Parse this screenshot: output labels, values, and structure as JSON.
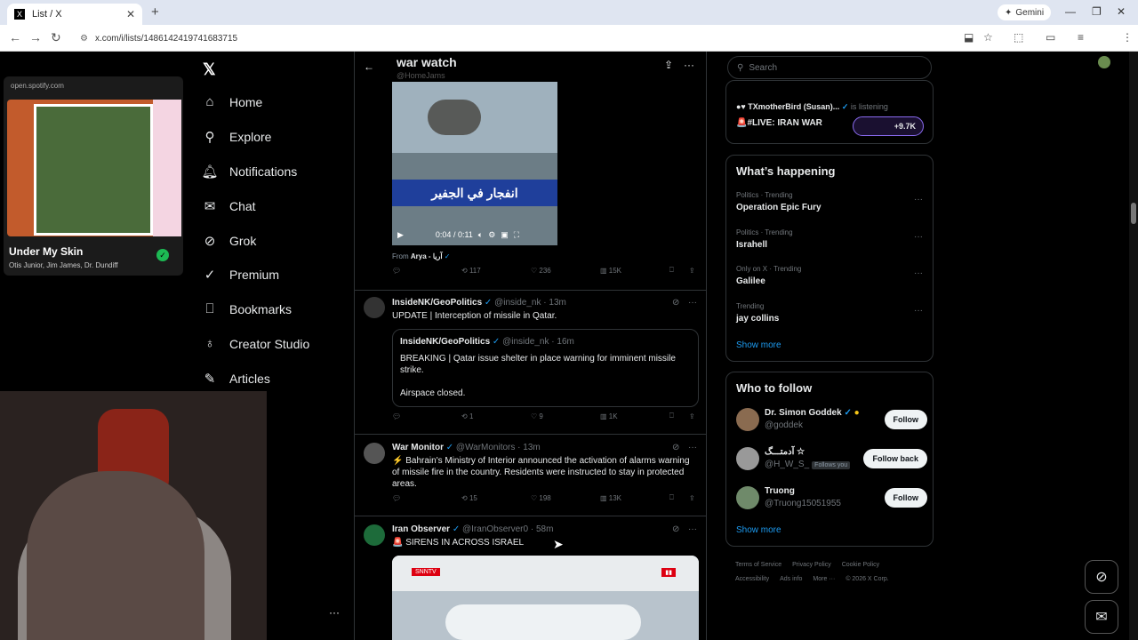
{
  "browser": {
    "tab_title": "List / X",
    "url": "x.com/i/lists/1486142419741683715",
    "gemini_label": "Gemini"
  },
  "spotify": {
    "source": "open.spotify.com",
    "song": "Under My Skin",
    "artists": "Otis Junior, Jim James, Dr. Dundiff"
  },
  "nav": {
    "items": [
      {
        "label": "Home",
        "icon": "home-icon"
      },
      {
        "label": "Explore",
        "icon": "search-icon"
      },
      {
        "label": "Notifications",
        "icon": "bell-icon"
      },
      {
        "label": "Chat",
        "icon": "mail-icon"
      },
      {
        "label": "Grok",
        "icon": "grok-icon"
      },
      {
        "label": "Premium",
        "icon": "premium-icon"
      },
      {
        "label": "Bookmarks",
        "icon": "bookmark-icon"
      },
      {
        "label": "Creator Studio",
        "icon": "creator-icon"
      },
      {
        "label": "Articles",
        "icon": "article-icon"
      }
    ]
  },
  "list": {
    "title": "war watch",
    "handle": "@HomeJams"
  },
  "video1": {
    "caption": "انفجار في الجفير",
    "time": "0:04 / 0:11",
    "from": "From",
    "from_name": "Arya - آریا",
    "stats": {
      "replies": "",
      "reposts": "117",
      "likes": "236",
      "views": "15K"
    }
  },
  "tweets": [
    {
      "name": "InsideNK/GeoPolitics",
      "handle": "@inside_nk · 13m",
      "text": "UPDATE | Interception of missile in Qatar.",
      "quote": {
        "name": "InsideNK/GeoPolitics",
        "handle": "@inside_nk · 16m",
        "text": "BREAKING | Qatar issue shelter in place warning for imminent missile strike.",
        "text2": "Airspace closed."
      },
      "stats": {
        "replies": "",
        "reposts": "1",
        "likes": "9",
        "views": "1K"
      }
    },
    {
      "name": "War Monitor",
      "handle": "@WarMonitors · 13m",
      "text": "⚡ Bahrain's Ministry of Interior announced the activation of alarms warning of missile fire in the country. Residents were instructed to stay in protected areas.",
      "stats": {
        "replies": "",
        "reposts": "15",
        "likes": "198",
        "views": "13K"
      }
    },
    {
      "name": "Iran Observer",
      "handle": "@IranObserver0 · 58m",
      "text": "🚨 SIRENS IN ACROSS ISRAEL",
      "video_label": "SNNTV"
    }
  ],
  "right": {
    "search_placeholder": "Search",
    "live_host": "TXmotherBird (Susan)...",
    "live_status": "is listening",
    "live_title": "🚨#LIVE: IRAN WAR",
    "live_count": "+9.7K",
    "happening_title": "What’s happening",
    "trends": [
      {
        "category": "Politics · Trending",
        "name": "Operation Epic Fury"
      },
      {
        "category": "Politics · Trending",
        "name": "Israhell"
      },
      {
        "category": "Only on X · Trending",
        "name": "Galilee"
      },
      {
        "category": "Trending",
        "name": "jay collins"
      }
    ],
    "show_more": "Show more",
    "wtf_title": "Who to follow",
    "follows": [
      {
        "name": "Dr. Simon Goddek",
        "handle": "@goddek",
        "button": "Follow",
        "follows_you": ""
      },
      {
        "name": "آدمتـــگ ☆",
        "handle": "@H_W_S_",
        "button": "Follow back",
        "follows_you": "Follows you"
      },
      {
        "name": "Truong",
        "handle": "@Truong15051955",
        "button": "Follow",
        "follows_you": ""
      }
    ],
    "footer": [
      "Terms of Service",
      "Privacy Policy",
      "Cookie Policy",
      "Accessibility",
      "Ads info",
      "More ···",
      "© 2026 X Corp."
    ]
  }
}
